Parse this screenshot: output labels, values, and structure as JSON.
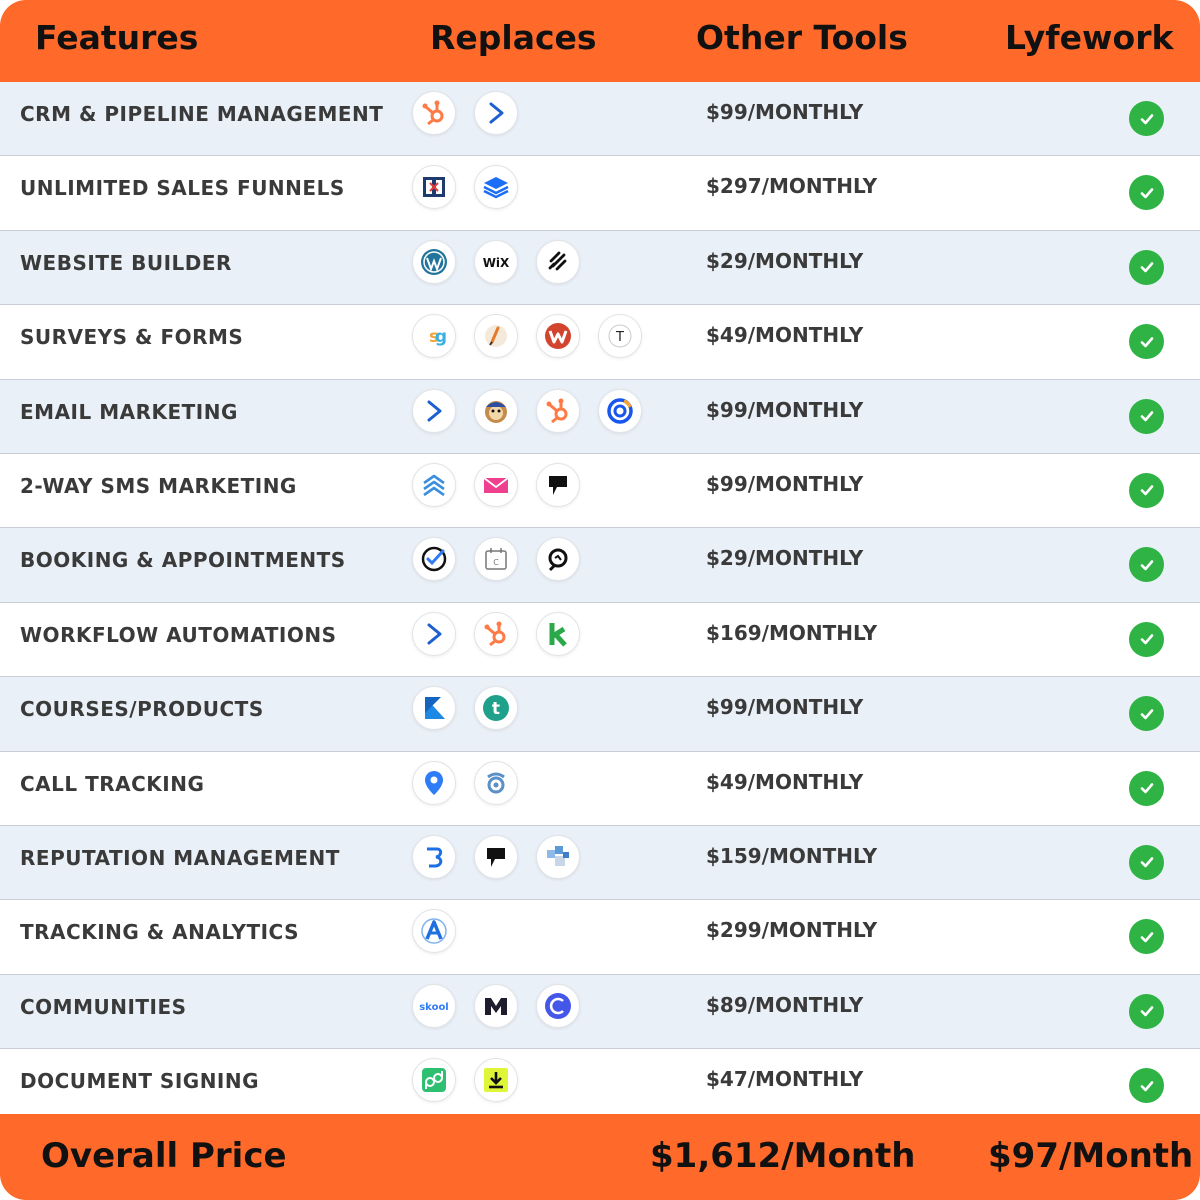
{
  "header": {
    "features": "Features",
    "replaces": "Replaces",
    "other_tools": "Other Tools",
    "brand": "Lyfework"
  },
  "rows": [
    {
      "feature": "CRM & PIPELINE MANAGEMENT",
      "price": "$99/MONTHLY",
      "logos": [
        "hubspot-icon",
        "activecampaign-icon"
      ]
    },
    {
      "feature": "UNLIMITED SALES FUNNELS",
      "price": "$297/MONTHLY",
      "logos": [
        "clickfunnels-icon",
        "layers-icon"
      ]
    },
    {
      "feature": "WEBSITE BUILDER",
      "price": "$29/MONTHLY",
      "logos": [
        "wordpress-icon",
        "wix-icon",
        "squarespace-icon"
      ]
    },
    {
      "feature": "SURVEYS & FORMS",
      "price": "$49/MONTHLY",
      "logos": [
        "surveygizmo-icon",
        "jotform-icon",
        "wufoo-icon",
        "typeform-icon"
      ]
    },
    {
      "feature": "EMAIL MARKETING",
      "price": "$99/MONTHLY",
      "logos": [
        "activecampaign-icon",
        "mailchimp-icon",
        "hubspot-icon",
        "constantcontact-icon"
      ]
    },
    {
      "feature": "2-WAY SMS MARKETING",
      "price": "$99/MONTHLY",
      "logos": [
        "chevrons-up-icon",
        "envelope-icon",
        "podium-icon"
      ]
    },
    {
      "feature": "BOOKING & APPOINTMENTS",
      "price": "$29/MONTHLY",
      "logos": [
        "acuity-check-icon",
        "calendly-icon",
        "calendar-search-icon"
      ]
    },
    {
      "feature": "WORKFLOW AUTOMATIONS",
      "price": "$169/MONTHLY",
      "logos": [
        "activecampaign-icon",
        "hubspot-icon",
        "keap-icon"
      ]
    },
    {
      "feature": "COURSES/PRODUCTS",
      "price": "$99/MONTHLY",
      "logos": [
        "kajabi-icon",
        "teachable-icon"
      ]
    },
    {
      "feature": "CALL TRACKING",
      "price": "$49/MONTHLY",
      "logos": [
        "location-pin-icon",
        "callrail-icon"
      ]
    },
    {
      "feature": "REPUTATION MANAGEMENT",
      "price": "$159/MONTHLY",
      "logos": [
        "birdeye-icon",
        "podium-icon",
        "puzzle-icon"
      ]
    },
    {
      "feature": "TRACKING & ANALYTICS",
      "price": "$299/MONTHLY",
      "logos": [
        "analytics-a-icon"
      ]
    },
    {
      "feature": "COMMUNITIES",
      "price": "$89/MONTHLY",
      "logos": [
        "skool-icon",
        "mighty-icon",
        "circle-c-icon"
      ]
    },
    {
      "feature": "DOCUMENT SIGNING",
      "price": "$47/MONTHLY",
      "logos": [
        "pandadoc-icon",
        "download-icon"
      ]
    }
  ],
  "footer": {
    "label": "Overall Price",
    "other_total": "$1,612/Month",
    "lyfework_total": "$97/Month"
  },
  "colors": {
    "accent": "#ff6a2b",
    "check": "#2fb344",
    "row_alt": "#eaf0f7"
  },
  "texts": {
    "wix": "WiX",
    "typeform": "T",
    "skool": "skool",
    "callrail": "C"
  }
}
